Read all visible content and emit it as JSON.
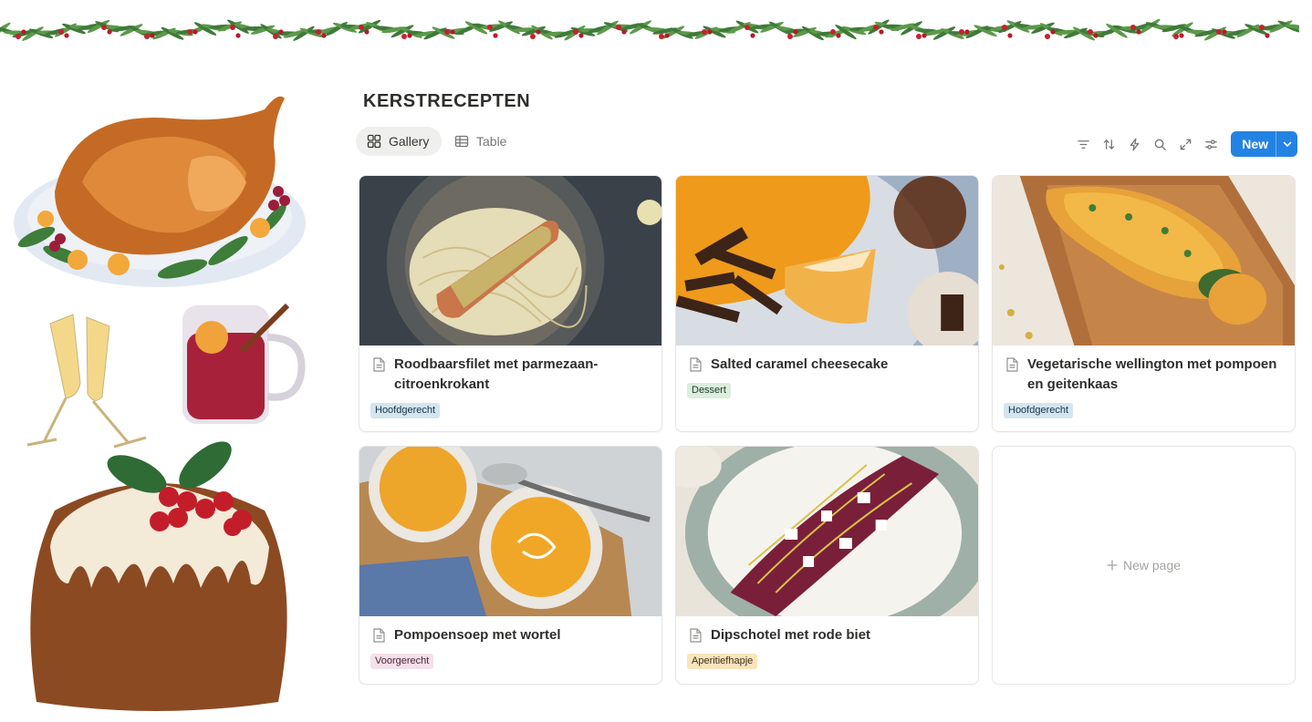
{
  "page": {
    "title": "KERSTRECEPTEN"
  },
  "views": [
    {
      "label": "Gallery",
      "icon": "gallery-icon",
      "active": true
    },
    {
      "label": "Table",
      "icon": "table-icon",
      "active": false
    }
  ],
  "toolbar": {
    "icons": [
      "filter-icon",
      "sort-icon",
      "automation-icon",
      "search-icon",
      "expand-icon",
      "settings-icon"
    ],
    "new_label": "New",
    "accent": "#2383e2"
  },
  "cards": [
    {
      "title": "Roodbaarsfilet met parmezaan-citroenkrokant",
      "tag": "Hoofdgerecht",
      "tag_color": "#d3e5ef"
    },
    {
      "title": "Salted caramel cheesecake",
      "tag": "Dessert",
      "tag_color": "#dbeddb"
    },
    {
      "title": "Vegetarische wellington met pompoen en geitenkaas",
      "tag": "Hoofdgerecht",
      "tag_color": "#d3e5ef"
    },
    {
      "title": "Pompoensoep met wortel",
      "tag": "Voorgerecht",
      "tag_color": "#f5e0e9"
    },
    {
      "title": "Dipschotel met rode biet",
      "tag": "Aperitiefhapje",
      "tag_color": "#f9e4bc"
    }
  ],
  "new_page_label": "New page"
}
